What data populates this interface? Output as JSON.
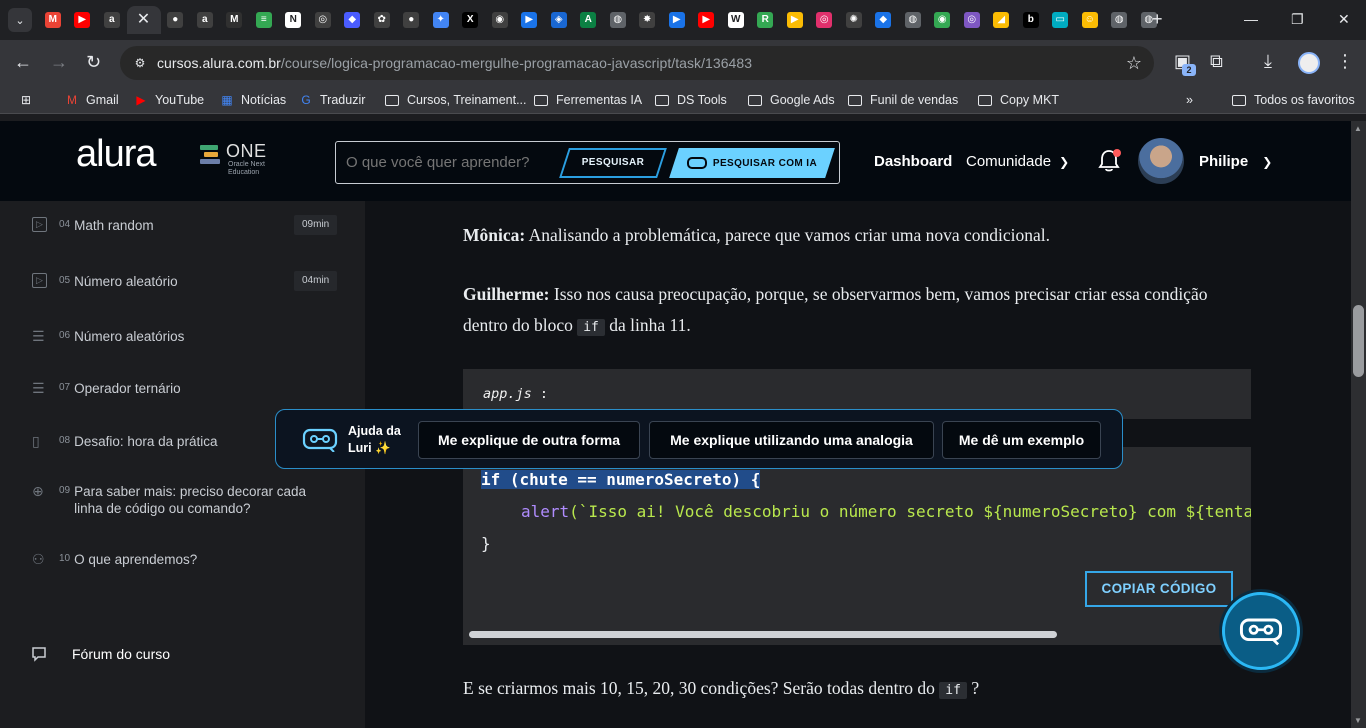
{
  "browser": {
    "tabs": [
      {
        "icon": "gmail-icon",
        "glyph": "M",
        "color": "#ea4335"
      },
      {
        "icon": "youtube-icon",
        "glyph": "▶",
        "color": "#ff0000"
      },
      {
        "icon": "alura-icon",
        "glyph": "a",
        "color": "#404040"
      },
      {
        "icon": "close-icon",
        "glyph": "✕",
        "color": "#35363a",
        "active": true
      },
      {
        "icon": "github-icon",
        "glyph": "●",
        "color": "#404040"
      },
      {
        "icon": "alura-icon",
        "glyph": "a",
        "color": "#404040"
      },
      {
        "icon": "medium-icon",
        "glyph": "M",
        "color": "#303030"
      },
      {
        "icon": "notes-icon",
        "glyph": "≡",
        "color": "#34a853"
      },
      {
        "icon": "notion-icon",
        "glyph": "N",
        "color": "#ffffff"
      },
      {
        "icon": "chatgpt-icon",
        "glyph": "◎",
        "color": "#404040"
      },
      {
        "icon": "app-icon",
        "glyph": "◆",
        "color": "#4a5cff"
      },
      {
        "icon": "app-icon",
        "glyph": "✿",
        "color": "#404040"
      },
      {
        "icon": "app-icon",
        "glyph": "●",
        "color": "#404040"
      },
      {
        "icon": "gemini-icon",
        "glyph": "✦",
        "color": "#4285f4"
      },
      {
        "icon": "x-icon",
        "glyph": "X",
        "color": "#000000"
      },
      {
        "icon": "app-icon",
        "glyph": "◉",
        "color": "#404040"
      },
      {
        "icon": "play-icon",
        "glyph": "▶",
        "color": "#1a73e8"
      },
      {
        "icon": "app-icon",
        "glyph": "◈",
        "color": "#1967d2"
      },
      {
        "icon": "app-icon",
        "glyph": "A",
        "color": "#0b8043"
      },
      {
        "icon": "globe-icon",
        "glyph": "◍",
        "color": "#5f6368"
      },
      {
        "icon": "app-icon",
        "glyph": "✸",
        "color": "#404040"
      },
      {
        "icon": "play-icon",
        "glyph": "▶",
        "color": "#1a73e8"
      },
      {
        "icon": "youtube-icon",
        "glyph": "▶",
        "color": "#ff0000"
      },
      {
        "icon": "wikipedia-icon",
        "glyph": "W",
        "color": "#ffffff"
      },
      {
        "icon": "app-icon",
        "glyph": "R",
        "color": "#34a853"
      },
      {
        "icon": "app-icon",
        "glyph": "▶",
        "color": "#fbbc04"
      },
      {
        "icon": "instagram-icon",
        "glyph": "◎",
        "color": "#e1306c"
      },
      {
        "icon": "app-icon",
        "glyph": "✺",
        "color": "#404040"
      },
      {
        "icon": "app-icon",
        "glyph": "◆",
        "color": "#1a73e8"
      },
      {
        "icon": "globe-icon",
        "glyph": "◍",
        "color": "#5f6368"
      },
      {
        "icon": "maps-icon",
        "glyph": "◉",
        "color": "#34a853"
      },
      {
        "icon": "app-icon",
        "glyph": "◎",
        "color": "#7e57c2"
      },
      {
        "icon": "app-icon",
        "glyph": "◢",
        "color": "#fbbc04"
      },
      {
        "icon": "app-icon",
        "glyph": "b",
        "color": "#000000"
      },
      {
        "icon": "app-icon",
        "glyph": "▭",
        "color": "#00acc1"
      },
      {
        "icon": "app-icon",
        "glyph": "☺",
        "color": "#fbbc04"
      },
      {
        "icon": "globe-icon",
        "glyph": "◍",
        "color": "#5f6368"
      },
      {
        "icon": "globe-icon",
        "glyph": "◍",
        "color": "#5f6368"
      }
    ],
    "url_host": "cursos.alura.com.br",
    "url_path": "/course/logica-programacao-mergulhe-programacao-javascript/task/136483",
    "extensions_badge": "2",
    "bookmarks": [
      {
        "label": "Gmail",
        "icon": "gmail-icon"
      },
      {
        "label": "YouTube",
        "icon": "youtube-icon"
      },
      {
        "label": "Notícias",
        "icon": "news-icon"
      },
      {
        "label": "Traduzir",
        "icon": "translate-icon"
      },
      {
        "label": "Cursos, Treinament...",
        "icon": "folder-icon"
      },
      {
        "label": "Ferrementas IA",
        "icon": "folder-icon"
      },
      {
        "label": "DS Tools",
        "icon": "folder-icon"
      },
      {
        "label": "Google Ads",
        "icon": "folder-icon"
      },
      {
        "label": "Funil de vendas",
        "icon": "folder-icon"
      },
      {
        "label": "Copy MKT",
        "icon": "folder-icon"
      }
    ],
    "all_bookmarks": "Todos os favoritos"
  },
  "header": {
    "logo": "alura",
    "one_logo": "ONE",
    "one_sub": "Oracle Next Education",
    "search_placeholder": "O que você quer aprender?",
    "search_button": "PESQUISAR",
    "search_ai_button": "PESQUISAR COM IA",
    "nav_dashboard": "Dashboard",
    "nav_community": "Comunidade",
    "user_name": "Philipe"
  },
  "sidebar": {
    "lessons": [
      {
        "num": "04",
        "title": "Math random",
        "duration": "09min",
        "icon": "video-icon"
      },
      {
        "num": "05",
        "title": "Número aleatório",
        "duration": "04min",
        "icon": "video-icon"
      },
      {
        "num": "06",
        "title": "Número aleatórios",
        "duration": "",
        "icon": "list-icon"
      },
      {
        "num": "07",
        "title": "Operador ternário",
        "duration": "",
        "icon": "list-icon"
      },
      {
        "num": "08",
        "title": "Desafio: hora da prática",
        "duration": "",
        "icon": "book-icon"
      },
      {
        "num": "09",
        "title": "Para saber mais: preciso decorar cada linha de código ou comando?",
        "duration": "",
        "icon": "plus-circle-icon"
      },
      {
        "num": "10",
        "title": "O que aprendemos?",
        "duration": "",
        "icon": "learner-icon"
      }
    ],
    "forum": "Fórum do curso"
  },
  "content": {
    "p1_speaker": "Mônica:",
    "p1_text": " Analisando a problemática, parece que vamos criar uma nova condicional.",
    "p2_speaker": "Guilherme:",
    "p2_text_a": " Isso nos causa preocupação, porque, se observarmos bem, vamos precisar criar essa condição dentro do bloco ",
    "p2_code": "if",
    "p2_text_b": " da linha 11.",
    "file_name": "app.js",
    "file_colon": ":",
    "code_line1": "if (chute == numeroSecreto) {",
    "code_line2_fn": "alert",
    "code_line2_rest": "(`Isso ai! Você descobriu o número secreto ${numeroSecreto} com ${tentativas",
    "code_line3": "}",
    "copy_button": "COPIAR CÓDIGO",
    "p3_text": "E se criarmos mais 10, 15, 20, 30 condições? Serão todas dentro do ",
    "p3_code": "if",
    "p3_end": " ?"
  },
  "luri": {
    "label_line1": "Ajuda da",
    "label_line2": "Luri ✨",
    "btn1": "Me explique de outra forma",
    "btn2": "Me explique utilizando uma analogia",
    "btn3": "Me dê um exemplo"
  },
  "colors": {
    "accent": "#6bd1ff",
    "header_bg": "#04090f",
    "code_bg": "#2a2b2e",
    "selection": "#214c8a"
  }
}
